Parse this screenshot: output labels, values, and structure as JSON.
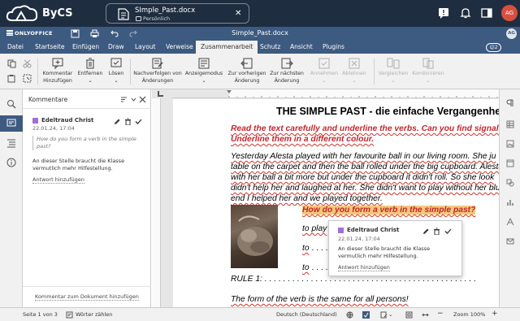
{
  "portal": {
    "brand": "ByCS",
    "tab_title": "SImple_Past.docx",
    "tab_subtitle": "Persönlich",
    "avatar_initials": "AG"
  },
  "editor": {
    "brand": "ONLYOFFICE",
    "doc_title": "Simple_Past.docx",
    "avatar_initials": "AG",
    "users_count": "2"
  },
  "menu_tabs": [
    "Datei",
    "Startseite",
    "Einfügen",
    "Draw",
    "Layout",
    "Verweise",
    "Zusammenarbeit",
    "Schutz",
    "Ansicht",
    "Plugins"
  ],
  "active_tab": "Zusammenarbeit",
  "toolbar": {
    "comment_add": [
      "Kommentar",
      "Hinzufügen"
    ],
    "remove": "Entfernen",
    "resolve": "Lösen",
    "track_changes": [
      "Nachverfolgen von",
      "Änderungen"
    ],
    "display_mode": "Anzeigemodus",
    "prev_change": [
      "Zur vorherigen",
      "Änderung"
    ],
    "next_change": [
      "Zur nächsten",
      "Änderung"
    ],
    "accept": "Annehmen",
    "reject": "Ablehnen",
    "compare": "Vergleichen",
    "combine": "Kombinieren"
  },
  "comments_panel": {
    "title": "Kommentare",
    "comment": {
      "author": "Edeltraud Christ",
      "date": "22.01.24, 17:04",
      "quote": "How do you form a verb in the simple past?",
      "text": "An dieser Stelle braucht die Klasse vermutlich mehr Hilfestellung.",
      "reply": "Antwort hinzufügen"
    },
    "add_doc_comment": "Kommentar zum Dokument hinzufügen"
  },
  "document": {
    "heading": "THE SIMPLE PAST - die einfache Vergangenheit",
    "instruction_1": "Read the text carefully and underline the verbs. Can you find signal w",
    "instruction_2": "Underline them in a different colour.",
    "para": [
      "Yesterday Alesta played with her favourite ball in our living room. She ju",
      "table on the carpet and then the ball rolled under the big cupboard. Alesta",
      "with her ball a bit more but under the cupboard it didn't roll. So she look",
      "didn't help her and laughed at her. She didn't want to play without her blu",
      "end I helped her and we played together."
    ],
    "question": "How do you form a verb in the simple past?",
    "to_lines": [
      "to play",
      "to",
      "to"
    ],
    "rule": "RULE 1:",
    "last_line": "The form of the verb is the same for all persons!"
  },
  "popup": {
    "author": "Edeltraud Christ",
    "date": "22.01.24, 17:04",
    "text": "An dieser Stelle braucht die Klasse vermutlich mehr Hilfestellung.",
    "reply": "Antwort hinzufügen"
  },
  "status": {
    "page": "Seite 1 von 3",
    "word_count": "Wörter zählen",
    "language": "Deutsch (Deutschland)",
    "zoom": "Zoom 100%"
  },
  "colors": {
    "portal_bg": "#1f2d40",
    "editor_bg": "#3d5a80",
    "comment_author": "#a070d8",
    "highlight": "#f5c77a"
  }
}
